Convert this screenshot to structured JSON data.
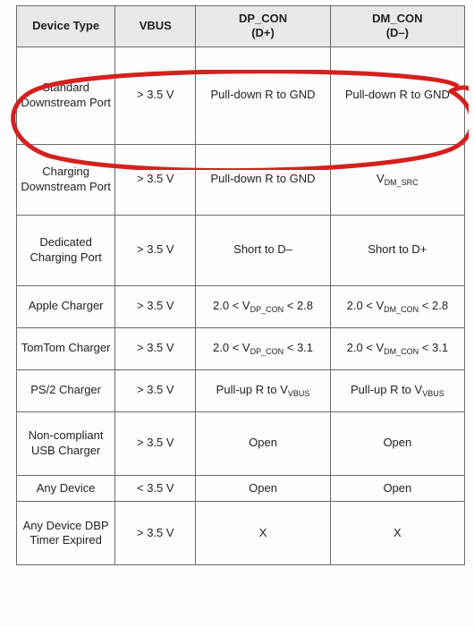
{
  "table": {
    "headers": {
      "device_type": "Device Type",
      "vbus": "VBUS",
      "dp_con_line1": "DP_CON",
      "dp_con_line2": "(D+)",
      "dm_con_line1": "DM_CON",
      "dm_con_line2": "(D–)"
    },
    "rows": [
      {
        "device": "Standard Downstream Port",
        "vbus": "> 3.5 V",
        "dp": "Pull-down R to GND",
        "dm": "Pull-down R to GND"
      },
      {
        "device": "Charging Downstream Port",
        "vbus": "> 3.5 V",
        "dp": "Pull-down R to GND",
        "dm_prefix": "V",
        "dm_sub": "DM_SRC"
      },
      {
        "device": "Dedicated Charging Port",
        "vbus": "> 3.5 V",
        "dp": "Short to D–",
        "dm": "Short to D+"
      },
      {
        "device": "Apple Charger",
        "vbus": "> 3.5 V",
        "dp_lo": "2.0 < V",
        "dp_sub": "DP_CON",
        "dp_hi": " < 2.8",
        "dm_lo": "2.0 < V",
        "dm_sub": "DM_CON",
        "dm_hi": " < 2.8"
      },
      {
        "device": "TomTom Charger",
        "vbus": "> 3.5 V",
        "dp_lo": "2.0 < V",
        "dp_sub": "DP_CON",
        "dp_hi": " < 3.1",
        "dm_lo": "2.0 < V",
        "dm_sub": "DM_CON",
        "dm_hi": " < 3.1"
      },
      {
        "device": "PS/2 Charger",
        "vbus": "> 3.5 V",
        "dp_txt": "Pull-up R to V",
        "dp_sub": "VBUS",
        "dm_txt": "Pull-up R to V",
        "dm_sub": "VBUS"
      },
      {
        "device": "Non-compliant USB Charger",
        "vbus": "> 3.5 V",
        "dp": "Open",
        "dm": "Open"
      },
      {
        "device": "Any Device",
        "vbus": "< 3.5 V",
        "dp": "Open",
        "dm": "Open"
      },
      {
        "device": "Any Device DBP Timer Expired",
        "vbus": "> 3.5 V",
        "dp": "X",
        "dm": "X"
      }
    ]
  },
  "annotation": {
    "type": "freehand-circle",
    "color": "#d4201f",
    "highlights_row": 0
  }
}
